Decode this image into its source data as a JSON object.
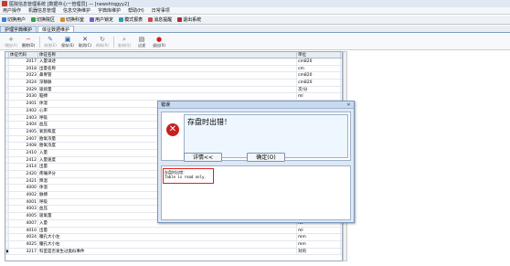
{
  "window": {
    "title": "医院信息管理系统 [数据中心一管理员] — [newshtqgyy2]"
  },
  "menu": [
    "用户操作",
    "机器信息管理",
    "信息交换维护",
    "字典库维护",
    "帮助(H)",
    "日常事项"
  ],
  "quickbar": [
    {
      "label": "切换用户",
      "color": "#3c7fd1"
    },
    {
      "label": "切换院区",
      "color": "#3aa04a"
    },
    {
      "label": "切换科室",
      "color": "#d98b2b"
    },
    {
      "label": "用户锁定",
      "color": "#7a5bc2"
    },
    {
      "label": "模式报表",
      "color": "#2c9db0"
    },
    {
      "label": "消息提醒",
      "color": "#d14a4a"
    },
    {
      "label": "退出系统",
      "color": "#b02a2a"
    }
  ],
  "tabs": [
    {
      "label": "护理字典维护",
      "active": false
    },
    {
      "label": "体征数据维护",
      "active": true
    }
  ],
  "toolbar": [
    {
      "label": "增加(A)",
      "icon": "add-icon",
      "glyph": "+",
      "color": "#3b8a3b",
      "disabled": true
    },
    {
      "label": "删除(D)",
      "icon": "delete-icon",
      "glyph": "−",
      "color": "#c33",
      "disabled": false
    },
    {
      "label": "修改(E)",
      "icon": "edit-icon",
      "glyph": "✎",
      "color": "#3b6fb6",
      "disabled": true
    },
    {
      "label": "保存(S)",
      "icon": "save-icon",
      "glyph": "▣",
      "color": "#2b5ea8",
      "disabled": false
    },
    {
      "label": "取消(C)",
      "icon": "cancel-icon",
      "glyph": "✕",
      "color": "#1b3f8a",
      "disabled": false
    },
    {
      "label": "刷新(R)",
      "icon": "refresh-icon",
      "glyph": "↻",
      "color": "#777",
      "disabled": true
    },
    {
      "label": "查询(Q)",
      "icon": "query-icon",
      "glyph": "⌕",
      "color": "#777",
      "disabled": true
    },
    {
      "label": "过滤",
      "icon": "filter-icon",
      "glyph": "▤",
      "color": "#555",
      "disabled": false
    },
    {
      "label": "退出(X)",
      "icon": "exit-icon",
      "glyph": "●",
      "color": "#d31b1b",
      "disabled": false
    }
  ],
  "table": {
    "columns": [
      "体征代码",
      "体征名称",
      "单位"
    ],
    "rows": [
      {
        "id": "2017",
        "name": "入量详述",
        "unit": "cm820"
      },
      {
        "id": "2018",
        "name": "出量名称",
        "unit": "cm"
      },
      {
        "id": "2023",
        "name": "鼻胃管",
        "unit": "cm820"
      },
      {
        "id": "2024",
        "name": "深静脉",
        "unit": "cm820"
      },
      {
        "id": "2029",
        "name": "吸痰量",
        "unit": "次/分"
      },
      {
        "id": "2030",
        "name": "脑搏",
        "unit": "ml"
      },
      {
        "id": "2401",
        "name": "体温",
        "unit": "次"
      },
      {
        "id": "2402",
        "name": "心率",
        "unit": "次/分"
      },
      {
        "id": "2403",
        "name": "呼吸",
        "unit": "次/分"
      },
      {
        "id": "2404",
        "name": "血压",
        "unit": "mmHg"
      },
      {
        "id": "2405",
        "name": "氧饱和度",
        "unit": "%"
      },
      {
        "id": "2407",
        "name": "胎氧浓量",
        "unit": "次"
      },
      {
        "id": "2408",
        "name": "胎氧浓度",
        "unit": "%"
      },
      {
        "id": "2410",
        "name": "入量",
        "unit": "ml"
      },
      {
        "id": "2412",
        "name": "入量速度",
        "unit": "ml"
      },
      {
        "id": "2414",
        "name": "出量",
        "unit": "ml"
      },
      {
        "id": "2420",
        "name": "疼痛评分",
        "unit": "分"
      },
      {
        "id": "2421",
        "name": "降温",
        "unit": "℃"
      },
      {
        "id": "4000",
        "name": "体温",
        "unit": "℃"
      },
      {
        "id": "4002",
        "name": "脉搏",
        "unit": "次/分"
      },
      {
        "id": "4001",
        "name": "呼吸",
        "unit": "次/分"
      },
      {
        "id": "4003",
        "name": "血压",
        "unit": "mmHg"
      },
      {
        "id": "4005",
        "name": "吸氧量",
        "unit": "L"
      },
      {
        "id": "4007",
        "name": "入量",
        "unit": "ml"
      },
      {
        "id": "4010",
        "name": "出量",
        "unit": "ml"
      },
      {
        "id": "4024",
        "name": "瞳孔大小左",
        "unit": "mm"
      },
      {
        "id": "4025",
        "name": "瞳孔大小右",
        "unit": "mm"
      },
      {
        "id": "3217",
        "name": "科室是否发生过类似事件",
        "unit": "对的",
        "current": true
      }
    ]
  },
  "dialog": {
    "title": "错误",
    "message": "存盘时出错！",
    "details_label": "详情<<",
    "ok_label": "确定(O)",
    "close_glyph": "✕",
    "detail_heading": "存盘时出错：",
    "detail_text": "Table is read only."
  }
}
